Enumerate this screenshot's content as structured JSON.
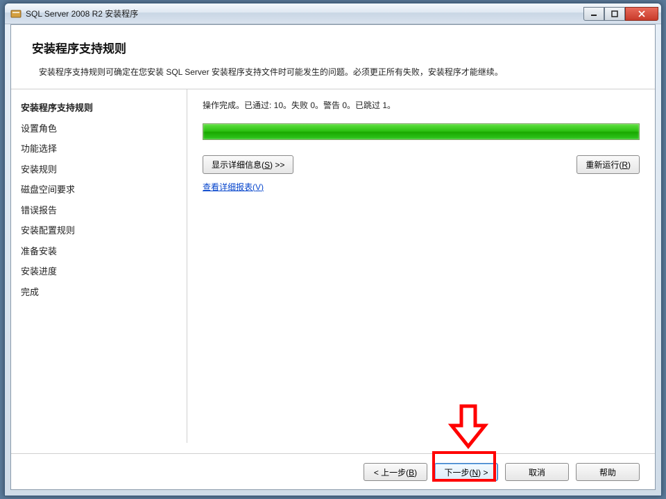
{
  "window": {
    "title": "SQL Server 2008 R2 安装程序"
  },
  "header": {
    "title": "安装程序支持规则",
    "description": "安装程序支持规则可确定在您安装 SQL Server 安装程序支持文件时可能发生的问题。必须更正所有失败，安装程序才能继续。"
  },
  "sidebar": {
    "items": [
      {
        "label": "安装程序支持规则",
        "active": true
      },
      {
        "label": "设置角色",
        "active": false
      },
      {
        "label": "功能选择",
        "active": false
      },
      {
        "label": "安装规则",
        "active": false
      },
      {
        "label": "磁盘空间要求",
        "active": false
      },
      {
        "label": "错误报告",
        "active": false
      },
      {
        "label": "安装配置规则",
        "active": false
      },
      {
        "label": "准备安装",
        "active": false
      },
      {
        "label": "安装进度",
        "active": false
      },
      {
        "label": "完成",
        "active": false
      }
    ]
  },
  "content": {
    "status": "操作完成。已通过: 10。失败 0。警告 0。已跳过 1。",
    "show_details": "显示详细信息(S) >>",
    "rerun": "重新运行(R)",
    "view_report": "查看详细报表(V)",
    "progress_percent": 100
  },
  "footer": {
    "back": "< 上一步(B)",
    "next": "下一步(N) >",
    "cancel": "取消",
    "help": "帮助"
  }
}
